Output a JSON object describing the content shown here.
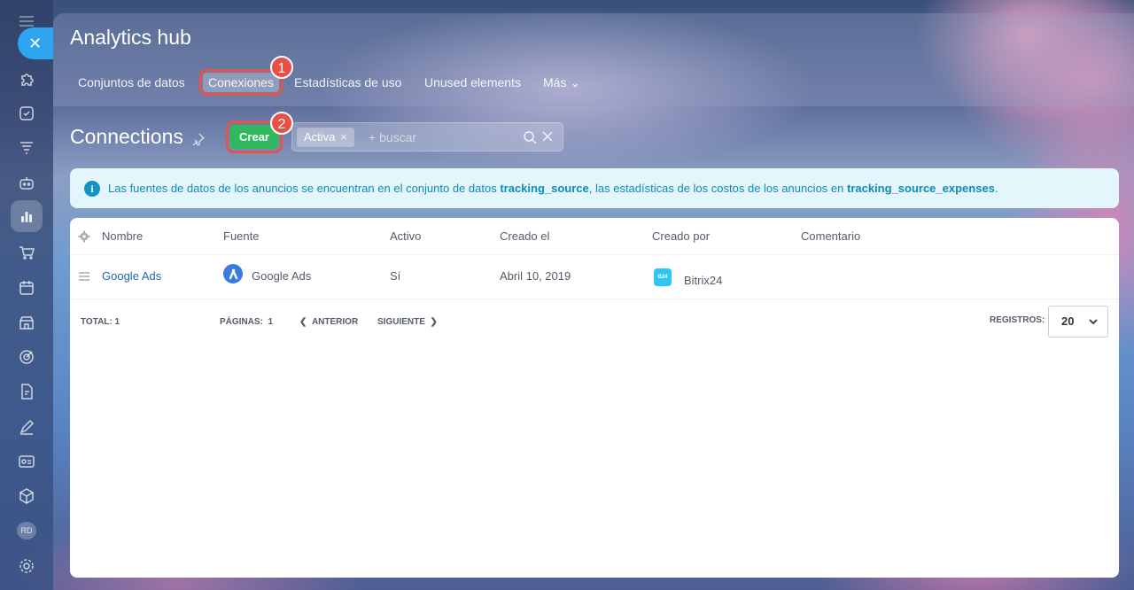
{
  "sidebar": {
    "close_glyph": "✕",
    "avatar_initials": "RD",
    "icons": [
      "menu-icon",
      "close-icon",
      "puzzle-icon",
      "tasks-icon",
      "filter-icon",
      "robot-icon",
      "analytics-icon",
      "cart-icon",
      "calendar-icon",
      "store-icon",
      "target-icon",
      "document-icon",
      "sign-icon",
      "id-card-icon",
      "box-icon",
      "settings-icon"
    ]
  },
  "header": {
    "title": "Analytics hub",
    "tabs": [
      {
        "label": "Conjuntos de datos"
      },
      {
        "label": "Conexiones"
      },
      {
        "label": "Estadísticas de uso"
      },
      {
        "label": "Unused elements"
      },
      {
        "label": "Más ⌄"
      }
    ],
    "annotation_1": "1",
    "annotation_2": "2"
  },
  "toolbar": {
    "page_title": "Connections",
    "create_label": "Crear",
    "filter_chip": "Activa",
    "filter_chip_remove": "×",
    "search_placeholder": "+ buscar"
  },
  "info": {
    "icon": "i",
    "text_1": "Las fuentes de datos de los anuncios se encuentran en el conjunto de datos ",
    "bold_1": "tracking_source",
    "text_2": ", las estadísticas de los costos de los anuncios en ",
    "bold_2": "tracking_source_expenses",
    "text_3": "."
  },
  "grid": {
    "columns": [
      "Nombre",
      "Fuente",
      "Activo",
      "Creado el",
      "Creado por",
      "Comentario"
    ],
    "rows": [
      {
        "name": "Google Ads",
        "source": "Google Ads",
        "active": "Sí",
        "created_on": "Abril 10, 2019",
        "created_by": "Bitrix24",
        "created_by_icon": "B24",
        "comment": ""
      }
    ]
  },
  "footer": {
    "total_label": "TOTAL:",
    "total_value": "1",
    "pages_label": "PÁGINAS:",
    "pages_value": "1",
    "prev_label": "ANTERIOR",
    "next_label": "SIGUIENTE",
    "records_label": "REGISTROS:",
    "records_value": "20"
  },
  "colors": {
    "accent_green": "#2fb85e",
    "link_blue": "#2067b0",
    "info_text": "#0d8cb8",
    "annotation_red": "#e94f43"
  }
}
